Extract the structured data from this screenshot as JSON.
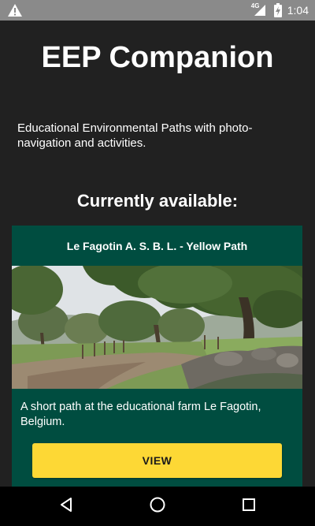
{
  "status_bar": {
    "network": "4G",
    "time": "1:04",
    "icons": [
      "warning-icon",
      "cell-signal-icon",
      "battery-icon"
    ]
  },
  "app": {
    "title": "EEP Companion",
    "description": "Educational Environmental Paths with photo-navigation and activities.",
    "section_heading": "Currently available:"
  },
  "paths": [
    {
      "title": "Le Fagotin A. S. B. L. - Yellow Path",
      "description": "A short path at the educational farm Le Fagotin, Belgium.",
      "button_label": "VIEW",
      "photo": "landscape-photo"
    }
  ],
  "nav_bar": {
    "icons": [
      "back-icon",
      "home-icon",
      "recents-icon"
    ]
  },
  "colors": {
    "background": "#212121",
    "status_bar": "#8a8a8a",
    "card": "#004d40",
    "button": "#fdd835",
    "nav_bar": "#000000"
  }
}
